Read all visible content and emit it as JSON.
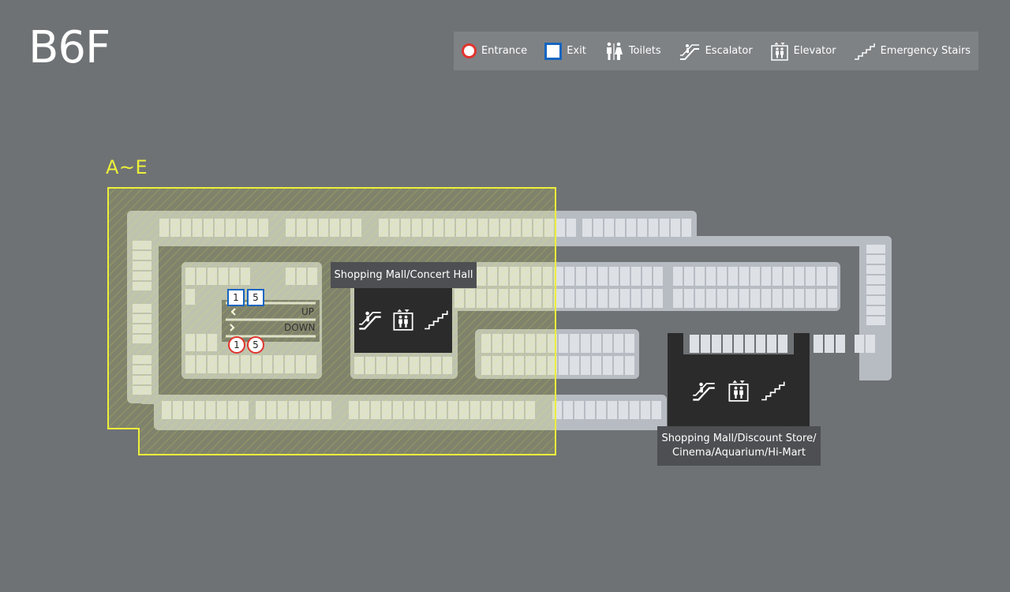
{
  "floor": {
    "title": "B6F"
  },
  "legend": {
    "items": [
      {
        "icon": "entrance-circle-icon",
        "label": "Entrance"
      },
      {
        "icon": "exit-square-icon",
        "label": "Exit"
      },
      {
        "icon": "toilets-icon",
        "label": "Toilets"
      },
      {
        "icon": "escalator-icon",
        "label": "Escalator"
      },
      {
        "icon": "elevator-icon",
        "label": "Elevator"
      },
      {
        "icon": "emergency-stairs-icon",
        "label": "Emergency Stairs"
      }
    ]
  },
  "zone": {
    "label": "A~E",
    "color": "#ecef3a"
  },
  "areas": {
    "west": {
      "label": "Shopping Mall/Concert Hall"
    },
    "east": {
      "label_line1": "Shopping Mall/Discount Store/",
      "label_line2": "Cinema/Aquarium/Hi-Mart"
    }
  },
  "gates": {
    "exits": [
      "1",
      "5"
    ],
    "entrances": [
      "1",
      "5"
    ]
  },
  "lanes": {
    "up": "UP",
    "down": "DOWN"
  },
  "colors": {
    "background": "#6f7275",
    "structure": "#b7bcc3",
    "parking_space": "#dde0e5",
    "entrance": "#e0342e",
    "exit": "#1565c0",
    "zone_highlight": "#ecef3a"
  }
}
